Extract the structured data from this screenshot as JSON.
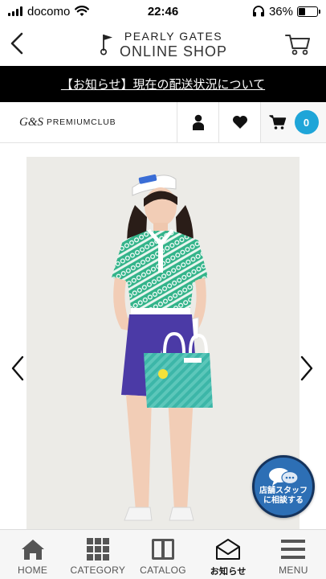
{
  "status_bar": {
    "carrier": "docomo",
    "time": "22:46",
    "battery": "36%",
    "battery_level": 0.36
  },
  "header": {
    "brand": "PEARLY GATES",
    "shop": "ONLINE SHOP",
    "icons": [
      "back-icon",
      "flag-logo-icon",
      "cart-icon"
    ]
  },
  "notice": {
    "text": "【お知らせ】現在の配送状況について"
  },
  "member_bar": {
    "club_gs": "G&S",
    "club_name": "PREMIUMCLUB",
    "cart_count": "0",
    "icons": [
      "person-icon",
      "heart-icon",
      "cart-icon"
    ]
  },
  "product": {
    "icons": [
      "chevron-left-icon",
      "chevron-right-icon"
    ]
  },
  "staff_button": {
    "line1": "店舗スタッフ",
    "line2": "に相談する"
  },
  "bottom_nav": {
    "items": [
      {
        "label": "HOME",
        "icon": "home-icon"
      },
      {
        "label": "CATEGORY",
        "icon": "grid-icon"
      },
      {
        "label": "CATALOG",
        "icon": "book-icon"
      },
      {
        "label": "お知らせ",
        "icon": "envelope-icon"
      },
      {
        "label": "MENU",
        "icon": "menu-icon"
      }
    ],
    "active_index": 3
  },
  "colors": {
    "notice_bg": "#000000",
    "badge": "#1fa5d8",
    "staff_button": "#2d6fb5",
    "product_bg": "#ecebe7"
  }
}
